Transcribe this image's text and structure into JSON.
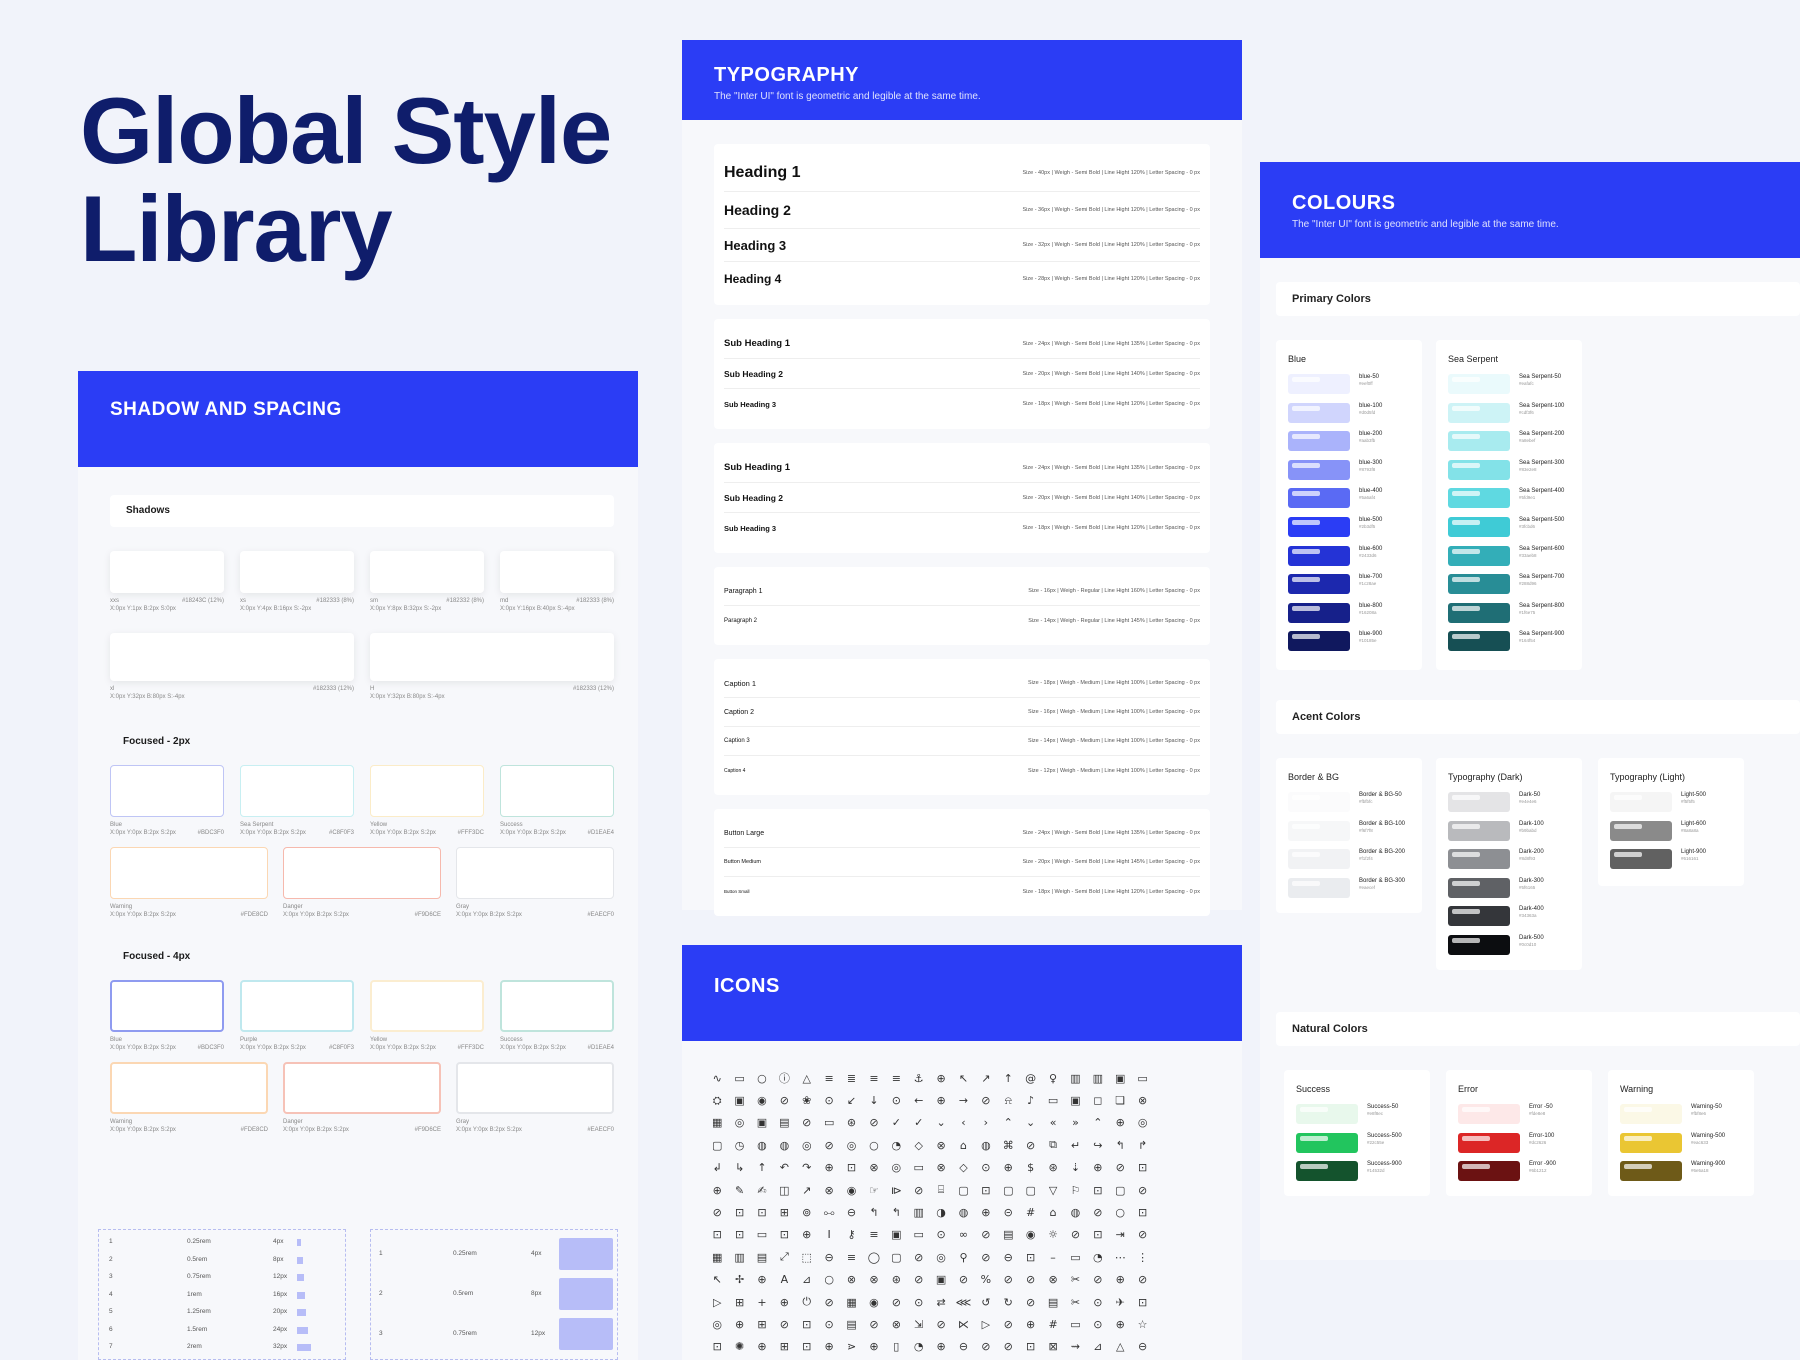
{
  "hero": {
    "line1": "Global Style",
    "line2": "Library"
  },
  "shadow": {
    "banner": "SHADOW AND SPACING",
    "shadows_title": "Shadows",
    "shadow_cards": [
      {
        "name": "xxs",
        "desc": "X:0px Y:1px B:2px S:0px",
        "hex": "#18243C (12%)"
      },
      {
        "name": "xs",
        "desc": "X:0px Y:4px B:16px S:-2px",
        "hex": "#182333 (8%)"
      },
      {
        "name": "sm",
        "desc": "X:0px Y:8px B:32px S:-2px",
        "hex": "#182332 (8%)"
      },
      {
        "name": "md",
        "desc": "X:0px Y:16px B:40px S:-4px",
        "hex": "#182333 (8%)"
      }
    ],
    "shadow_wide": [
      {
        "name": "xl",
        "desc": "X:0px Y:32px B:80px S:-4px",
        "hex": "#182333 (12%)"
      },
      {
        "name": "H",
        "desc": "X:0px Y:32px B:80px S:-4px",
        "hex": "#182333 (12%)"
      }
    ],
    "focused2": "Focused - 2px",
    "focused4": "Focused - 4px",
    "focus_a": [
      {
        "name": "Blue",
        "desc": "X:0px Y:0px B:2px S:2px",
        "hex": "#BDC3F0",
        "color": "#bfc5f5"
      },
      {
        "name": "Sea Serpent",
        "desc": "X:0px Y:0px B:2px S:2px",
        "hex": "#C8F0F3",
        "color": "#c8eff2"
      },
      {
        "name": "Yellow",
        "desc": "X:0px Y:0px B:2px S:2px",
        "hex": "#FFF3DC",
        "color": "#fbecc8"
      },
      {
        "name": "Success",
        "desc": "X:0px Y:0px B:2px S:2px",
        "hex": "#D1EAE4",
        "color": "#bfe4dc"
      }
    ],
    "focus_b": [
      {
        "name": "Warning",
        "desc": "X:0px Y:0px B:2px S:2px",
        "hex": "#FDE8CD",
        "color": "#fbd7b3"
      },
      {
        "name": "Danger",
        "desc": "X:0px Y:0px B:2px S:2px",
        "hex": "#F9D6CE",
        "color": "#f6b9ad"
      },
      {
        "name": "Gray",
        "desc": "X:0px Y:0px B:2px S:2px",
        "hex": "#EAECF0",
        "color": "#e4e6ea"
      }
    ],
    "focus_c": [
      {
        "name": "Blue",
        "desc": "X:0px Y:0px B:2px S:2px",
        "hex": "#BDC3F0",
        "color": "#8f9bf0"
      },
      {
        "name": "Purple",
        "desc": "X:0px Y:0px B:2px S:2px",
        "hex": "#C8F0F3",
        "color": "#bfe8ee"
      },
      {
        "name": "Yellow",
        "desc": "X:0px Y:0px B:2px S:2px",
        "hex": "#FFF3DC",
        "color": "#fbedd0"
      },
      {
        "name": "Success",
        "desc": "X:0px Y:0px B:2px S:2px",
        "hex": "#D1EAE4",
        "color": "#bfe4dc"
      }
    ],
    "focus_d": [
      {
        "name": "Warning",
        "desc": "X:0px Y:0px B:2px S:2px",
        "hex": "#FDE8CD",
        "color": "#fbd7b3"
      },
      {
        "name": "Danger",
        "desc": "X:0px Y:0px B:2px S:2px",
        "hex": "#F9D6CE",
        "color": "#f6c2b7"
      },
      {
        "name": "Gray",
        "desc": "X:0px Y:0px B:2px S:2px",
        "hex": "#EAECF0",
        "color": "#e4e6ea"
      }
    ],
    "spacing": [
      {
        "n": "1",
        "rem": "0.25rem",
        "px": "4px",
        "w": 4
      },
      {
        "n": "2",
        "rem": "0.5rem",
        "px": "8px",
        "w": 6
      },
      {
        "n": "3",
        "rem": "0.75rem",
        "px": "12px",
        "w": 7
      },
      {
        "n": "4",
        "rem": "1rem",
        "px": "16px",
        "w": 8
      },
      {
        "n": "5",
        "rem": "1.25rem",
        "px": "20px",
        "w": 9
      },
      {
        "n": "6",
        "rem": "1.5rem",
        "px": "24px",
        "w": 11
      },
      {
        "n": "7",
        "rem": "2rem",
        "px": "32px",
        "w": 14
      }
    ],
    "spacing_big": [
      {
        "n": "1",
        "rem": "0.25rem",
        "px": "4px"
      },
      {
        "n": "2",
        "rem": "0.5rem",
        "px": "8px"
      },
      {
        "n": "3",
        "rem": "0.75rem",
        "px": "12px"
      }
    ]
  },
  "typography": {
    "banner": "TYPOGRAPHY",
    "sub": "The \"Inter UI\" font is geometric and legible at the same time.",
    "groups": [
      [
        {
          "label": "Heading 1",
          "spec": "Size - 40px | Weigh - Semi Bold | Line Hight 120% | Letter Spacing - 0 px",
          "fs": 16,
          "fw": 700
        },
        {
          "label": "Heading 2",
          "spec": "Size - 36px | Weigh - Semi Bold | Line Hight 120% | Letter Spacing - 0 px",
          "fs": 14,
          "fw": 700
        },
        {
          "label": "Heading 3",
          "spec": "Size - 32px | Weigh - Semi Bold | Line Hight 120% | Letter Spacing - 0 px",
          "fs": 13,
          "fw": 700
        },
        {
          "label": "Heading 4",
          "spec": "Size - 28px | Weigh - Semi Bold | Line Hight 120% | Letter Spacing - 0 px",
          "fs": 12,
          "fw": 700
        }
      ],
      [
        {
          "label": "Sub Heading 1",
          "spec": "Size - 24px | Weigh - Semi Bold | Line Hight 135% | Letter Spacing - 0 px",
          "fs": 9.5,
          "fw": 700
        },
        {
          "label": "Sub Heading 2",
          "spec": "Size - 20px | Weigh - Semi Bold | Line Hight 140% | Letter Spacing - 0 px",
          "fs": 8.5,
          "fw": 700
        },
        {
          "label": "Sub Heading 3",
          "spec": "Size - 18px | Weigh - Semi Bold | Line Hight 120% | Letter Spacing - 0 px",
          "fs": 7.5,
          "fw": 700
        }
      ],
      [
        {
          "label": "Sub Heading 1",
          "spec": "Size - 24px | Weigh - Semi Bold | Line Hight 135% | Letter Spacing - 0 px",
          "fs": 9.5,
          "fw": 700
        },
        {
          "label": "Sub Heading 2",
          "spec": "Size - 20px | Weigh - Semi Bold | Line Hight 140% | Letter Spacing - 0 px",
          "fs": 8.5,
          "fw": 700
        },
        {
          "label": "Sub Heading 3",
          "spec": "Size - 18px | Weigh - Semi Bold | Line Hight 120% | Letter Spacing - 0 px",
          "fs": 7.5,
          "fw": 700
        }
      ],
      [
        {
          "label": "Paragraph 1",
          "spec": "Size - 16px | Weigh - Regular | Line Hight 160% | Letter Spacing - 0 px",
          "fs": 7,
          "fw": 400
        },
        {
          "label": "Paragraph 2",
          "spec": "Size - 14px | Weigh - Regular | Line Hight 145% | Letter Spacing - 0 px",
          "fs": 6,
          "fw": 400
        }
      ],
      [
        {
          "label": "Caption 1",
          "spec": "Size - 18px | Weigh - Medium | Line Hight 100% | Letter Spacing - 0 px",
          "fs": 7.5,
          "fw": 400
        },
        {
          "label": "Caption 2",
          "spec": "Size - 16px | Weigh - Medium | Line Hight 100% | Letter Spacing - 0 px",
          "fs": 7,
          "fw": 400
        },
        {
          "label": "Caption 3",
          "spec": "Size - 14px | Weigh - Medium | Line Hight 100% | Letter Spacing - 0 px",
          "fs": 6,
          "fw": 400
        },
        {
          "label": "Caption 4",
          "spec": "Size - 12px | Weigh - Medium | Line Hight 100% | Letter Spacing - 0 px",
          "fs": 5,
          "fw": 400
        }
      ],
      [
        {
          "label": "Button Large",
          "spec": "Size - 24px | Weigh - Semi Bold | Line Hight 135% | Letter Spacing - 0 px",
          "fs": 7,
          "fw": 400
        },
        {
          "label": "Button Medium",
          "spec": "Size - 20px | Weigh - Semi Bold | Line Hight 145% | Letter Spacing - 0 px",
          "fs": 5.5,
          "fw": 400
        },
        {
          "label": "Button Small",
          "spec": "Size - 18px | Weigh - Semi Bold | Line Hight 120% | Letter Spacing - 0 px",
          "fs": 4.5,
          "fw": 400
        }
      ]
    ]
  },
  "icons": {
    "banner": "ICONS",
    "glyphs": "∿▭○ⓘ△≡≣≡≡⚓⊕↖↗↑@♀▥▥▣▭⛭▣◉⊘❀⊙↙↓⊙←⊕→⊘⍾♪▭▣◻❏⊗▦◎▣▤⊘▭⊛⊘✓✓⌄‹›⌃⌄«»⌃⊕◎▢◷◍◍◎⊘◎○◔◇⊗⌂◍⌘⊘⧉↵↪↰↱↲↳↑↶↷⊕⊡⊗◎▭⊗◇⊙⊕$⊛⇣⊕⊘⊡⊕✎✍◫↗⊗◉☞⧐⊘⌸▢⊡▢▢▽⚐⊡▢⊘⊘⊡⊡⊞⊚⧟⊖↰↰▥◑◍⊕⊝#⌂◍⊘○⊡⊡⊡▭⊡⊕I⚷≡▣▭⊙∞⊘▤◉☼⊘⊡⇥⊘▦▥▤⤢⬚⊖≡◯▢⊘◎⚲⊘⊖⊡–▭◔⋯⋮↖✢⊕A⊿○⊗⊗⊛⊘▣⊘%⊘⊘⊗✂⊘⊕⊘▷⊞+⊕⏻⊘▦◉⊘⊙⇄⋘↺↻⊘▤✂⊙✈⊡◎⊕⊞⊘⊡⊙▤⊘⊗⇲⊘⋉▷⊘⊕#▭⊙⊕☆⊡✺⊕⊞⊡⊕⋗⊕▯◔⊕⊖⊘⊘⊡⊠⇝⊿△⊖⊡⊘⊗⊕⊕⊡▿⊘⊕⊙⊗⊘⊥⊓⊥⊡⊕"
  },
  "colours": {
    "banner": "COLOURS",
    "sub": "The \"Inter UI\" font is geometric and legible at the same time.",
    "primary_title": "Primary Colors",
    "accent_title": "Acent Colors",
    "natural_title": "Natural  Colors",
    "blue": {
      "title": "Blue",
      "items": [
        {
          "name": "blue-50",
          "hex": "#eef0ff"
        },
        {
          "name": "blue-100",
          "hex": "#d0d5fd"
        },
        {
          "name": "blue-200",
          "hex": "#aab3fb"
        },
        {
          "name": "blue-300",
          "hex": "#8793f8"
        },
        {
          "name": "blue-400",
          "hex": "#5a6af4"
        },
        {
          "name": "blue-500",
          "hex": "#2b3df5"
        },
        {
          "name": "blue-600",
          "hex": "#2433d6"
        },
        {
          "name": "blue-700",
          "hex": "#1c28ae"
        },
        {
          "name": "blue-800",
          "hex": "#16208a"
        },
        {
          "name": "blue-900",
          "hex": "#10185e"
        }
      ]
    },
    "sea": {
      "title": "Sea Serpent",
      "items": [
        {
          "name": "Sea Serpent-50",
          "hex": "#eafafc"
        },
        {
          "name": "Sea Serpent-100",
          "hex": "#cdf3f6"
        },
        {
          "name": "Sea Serpent-200",
          "hex": "#a8ebef"
        },
        {
          "name": "Sea Serpent-300",
          "hex": "#83e2e8"
        },
        {
          "name": "Sea Serpent-400",
          "hex": "#5fd9e1"
        },
        {
          "name": "Sea Serpent-500",
          "hex": "#3fcbd6"
        },
        {
          "name": "Sea Serpent-600",
          "hex": "#33aeb8"
        },
        {
          "name": "Sea Serpent-700",
          "hex": "#288d96"
        },
        {
          "name": "Sea Serpent-800",
          "hex": "#1f6e75"
        },
        {
          "name": "Sea Serpent-900",
          "hex": "#164f54"
        }
      ]
    },
    "border": {
      "title": "Border & BG",
      "items": [
        {
          "name": "Border & BG-50",
          "hex": "#fbfbfc"
        },
        {
          "name": "Border & BG-100",
          "hex": "#f6f7f8"
        },
        {
          "name": "Border & BG-200",
          "hex": "#f1f2f4"
        },
        {
          "name": "Border & BG-300",
          "hex": "#eaecef"
        }
      ]
    },
    "dark": {
      "title": "Typography (Dark)",
      "items": [
        {
          "name": "Dark-50",
          "hex": "#e4e4e6"
        },
        {
          "name": "Dark-100",
          "hex": "#b9babd"
        },
        {
          "name": "Dark-200",
          "hex": "#8d8f93"
        },
        {
          "name": "Dark-300",
          "hex": "#5f6165"
        },
        {
          "name": "Dark-400",
          "hex": "#34363a"
        },
        {
          "name": "Dark-500",
          "hex": "#0c0d10"
        }
      ]
    },
    "light": {
      "title": "Typography (Light)",
      "items": [
        {
          "name": "Light-500",
          "hex": "#f5f5f5"
        },
        {
          "name": "Light-600",
          "hex": "#8a8a8a"
        },
        {
          "name": "Light-900",
          "hex": "#616161"
        }
      ]
    },
    "success": {
      "title": "Success",
      "items": [
        {
          "name": "Success-50",
          "hex": "#e8f8ec"
        },
        {
          "name": "Success-500",
          "hex": "#22c55e"
        },
        {
          "name": "Success-900",
          "hex": "#14532d"
        }
      ]
    },
    "error": {
      "title": "Error",
      "items": [
        {
          "name": "Error -50",
          "hex": "#fde8e8"
        },
        {
          "name": "Error-100",
          "hex": "#dc2626"
        },
        {
          "name": "Error -900",
          "hex": "#6b1212"
        }
      ]
    },
    "warning": {
      "title": "Warning",
      "items": [
        {
          "name": "Warning-50",
          "hex": "#fbf8e6"
        },
        {
          "name": "Warning-500",
          "hex": "#eac633"
        },
        {
          "name": "Warning-900",
          "hex": "#6e5a18"
        }
      ]
    }
  }
}
